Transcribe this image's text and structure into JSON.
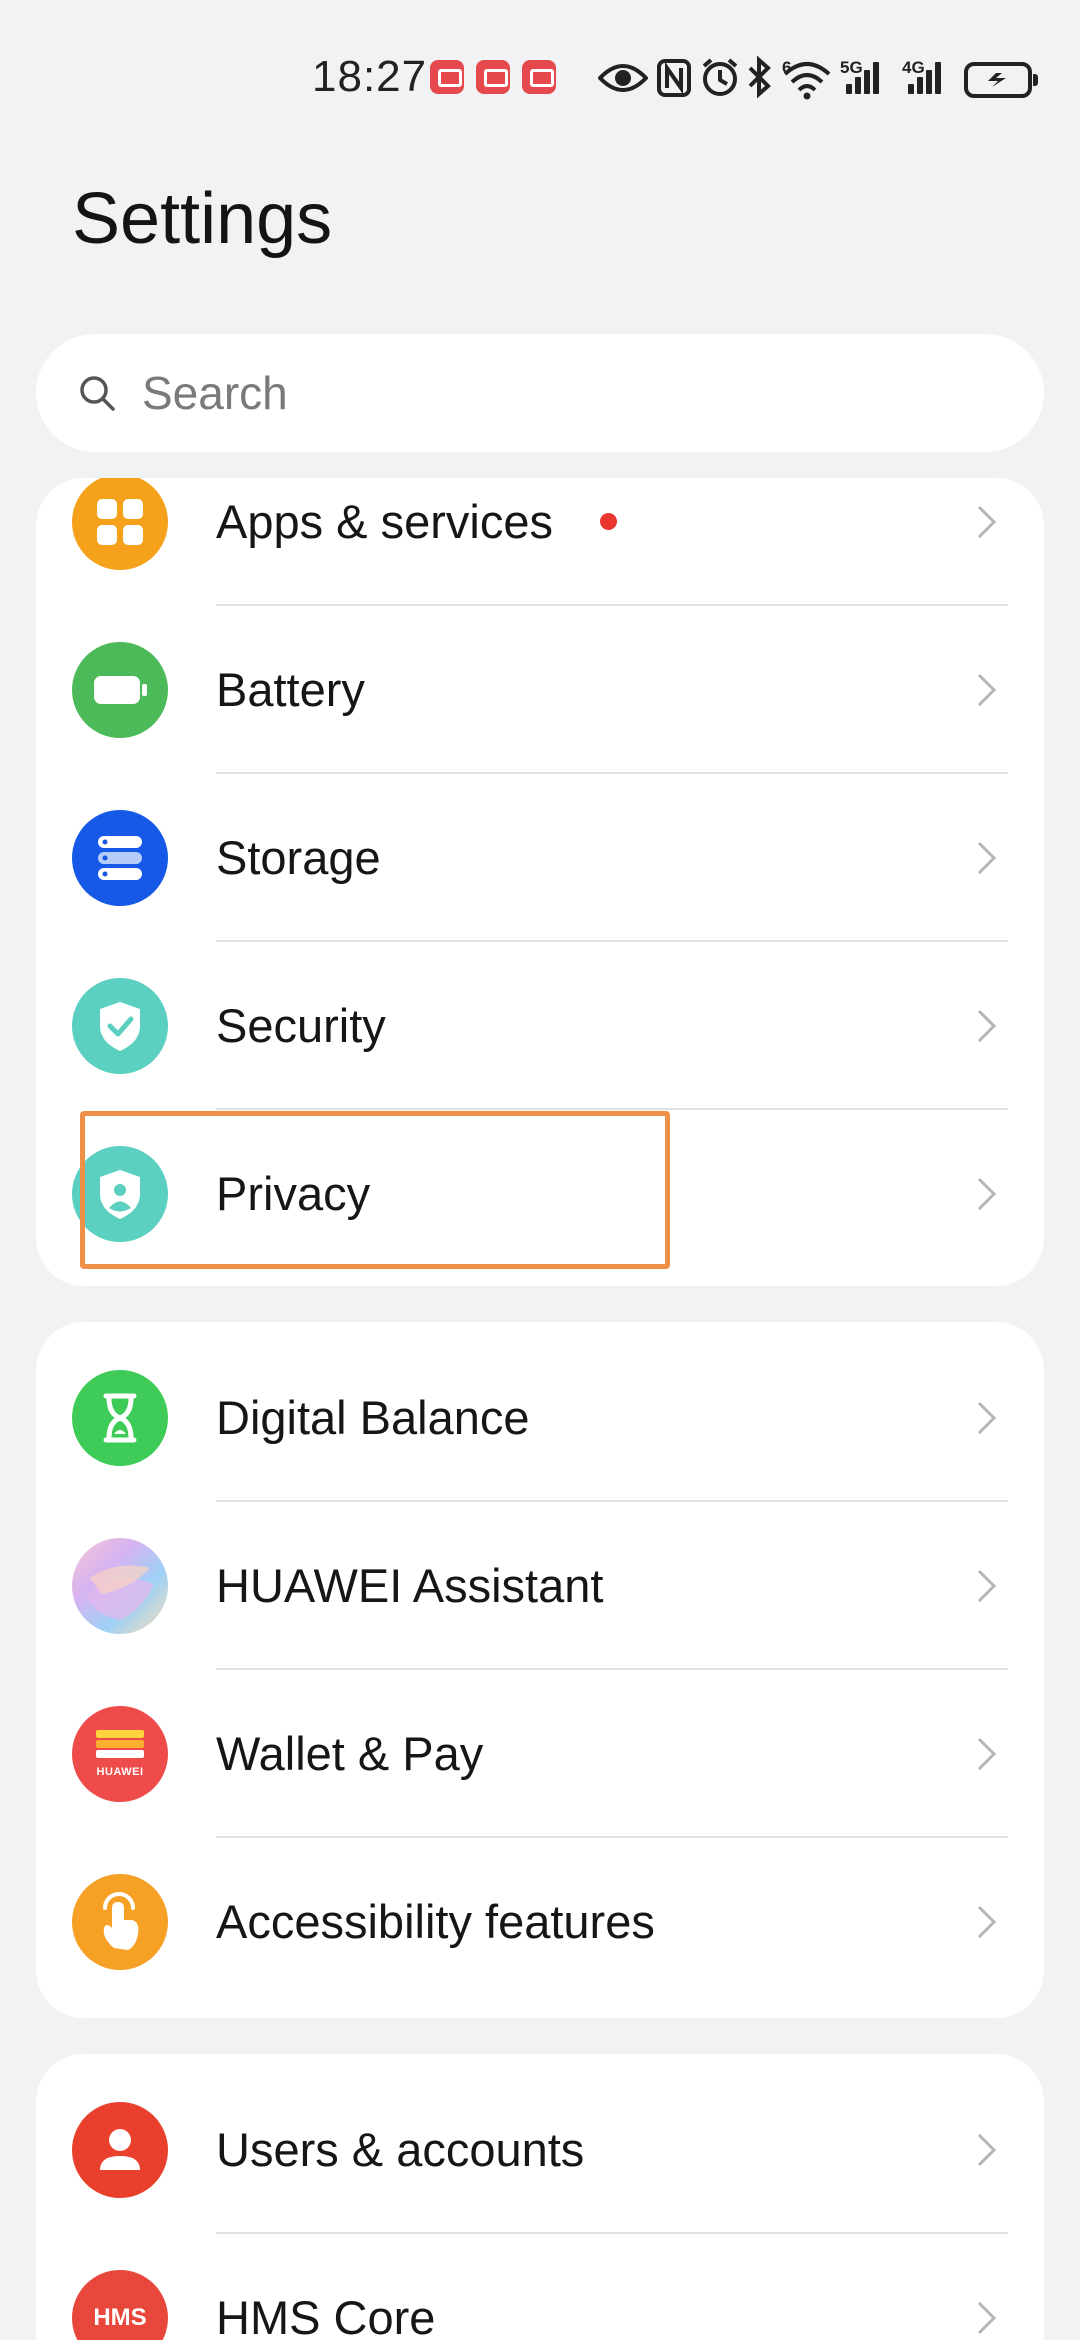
{
  "status_bar": {
    "time": "18:27",
    "net_5g": "5G",
    "net_4g": "4G",
    "wifi_tag": "6",
    "icons": [
      "huawei-store-notification-icon",
      "book-notification-icon",
      "huawei-store-notification-icon",
      "eye-comfort-icon",
      "nfc-icon",
      "alarm-icon",
      "bluetooth-icon",
      "wifi-icon",
      "signal-icon",
      "signal-icon",
      "battery-charging-icon"
    ]
  },
  "page": {
    "title": "Settings"
  },
  "search": {
    "placeholder": "Search"
  },
  "group1": {
    "items": [
      {
        "label": "Apps & services",
        "icon": "apps-grid-icon",
        "color": "#f5a11c",
        "badge": true
      },
      {
        "label": "Battery",
        "icon": "battery-icon",
        "color": "#4cba58"
      },
      {
        "label": "Storage",
        "icon": "storage-icon",
        "color": "#1559e6"
      },
      {
        "label": "Security",
        "icon": "shield-check-icon",
        "color": "#5bd0c0"
      },
      {
        "label": "Privacy",
        "icon": "privacy-shield-icon",
        "color": "#5bd0c0"
      }
    ]
  },
  "group2": {
    "items": [
      {
        "label": "Digital Balance",
        "icon": "hourglass-icon",
        "color": "#3ecb57"
      },
      {
        "label": "HUAWEI Assistant",
        "icon": "assistant-icon",
        "color": "#c8a8e8"
      },
      {
        "label": "Wallet & Pay",
        "icon": "wallet-icon",
        "color": "#ee4c4a",
        "icon_text": "HUAWEI"
      },
      {
        "label": "Accessibility features",
        "icon": "hand-touch-icon",
        "color": "#f6a126"
      }
    ]
  },
  "group3": {
    "items": [
      {
        "label": "Users & accounts",
        "icon": "user-icon",
        "color": "#e9402e"
      },
      {
        "label": "HMS Core",
        "icon": "hms-icon",
        "color": "#e8473c",
        "icon_text": "HMS"
      }
    ]
  }
}
